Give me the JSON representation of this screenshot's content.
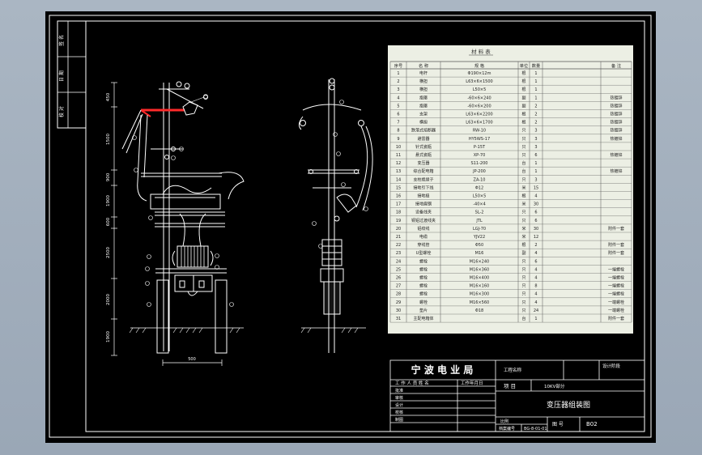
{
  "sheet": {
    "side_strip": [
      "签 名",
      "日 期",
      "校 对"
    ],
    "dims_left": [
      "450",
      "1500",
      "900",
      "1900",
      "600",
      "2500",
      "2000",
      "1900"
    ],
    "bottom_dim": "500"
  },
  "material_table": {
    "title": "材  料  表",
    "headers": [
      "序号",
      "名 称",
      "规 格",
      "单位",
      "数量",
      "备 注"
    ],
    "rows": [
      [
        "1",
        "电杆",
        "Φ190×12m",
        "根",
        "1",
        ""
      ],
      [
        "2",
        "横担",
        "L63×6×1500",
        "根",
        "1",
        ""
      ],
      [
        "3",
        "横担",
        "L50×5",
        "根",
        "1",
        ""
      ],
      [
        "4",
        "抱箍",
        "-60×6×240",
        "副",
        "1",
        "热镀锌"
      ],
      [
        "5",
        "抱箍",
        "-60×6×200",
        "副",
        "2",
        "热镀锌"
      ],
      [
        "6",
        "支架",
        "L63×6×2200",
        "根",
        "2",
        "热镀锌"
      ],
      [
        "7",
        "横担",
        "L63×6×1700",
        "根",
        "2",
        "热镀锌"
      ],
      [
        "8",
        "跌落式熔断器",
        "RW-10",
        "只",
        "3",
        "热镀锌"
      ],
      [
        "9",
        "避雷器",
        "HY5WS-17",
        "只",
        "3",
        "热镀锌"
      ],
      [
        "10",
        "针式瓷瓶",
        "P-15T",
        "只",
        "3",
        ""
      ],
      [
        "11",
        "悬式瓷瓶",
        "XP-70",
        "只",
        "6",
        "热镀锌"
      ],
      [
        "12",
        "变压器",
        "S11-200",
        "台",
        "1",
        ""
      ],
      [
        "13",
        "综合配电箱",
        "JP-200",
        "台",
        "1",
        "热镀锌"
      ],
      [
        "14",
        "支柱绝缘子",
        "ZA-10",
        "只",
        "3",
        ""
      ],
      [
        "15",
        "接地引下线",
        "Φ12",
        "米",
        "15",
        ""
      ],
      [
        "16",
        "接地极",
        "L50×5",
        "根",
        "4",
        ""
      ],
      [
        "17",
        "接地扁钢",
        "-40×4",
        "米",
        "30",
        ""
      ],
      [
        "18",
        "设备线夹",
        "SL-2",
        "只",
        "6",
        ""
      ],
      [
        "19",
        "铜铝过渡线夹",
        "JTL",
        "只",
        "6",
        ""
      ],
      [
        "20",
        "铝绞线",
        "LGJ-70",
        "米",
        "30",
        "附件一套"
      ],
      [
        "21",
        "电缆",
        "YJV22",
        "米",
        "12",
        ""
      ],
      [
        "22",
        "穿线管",
        "Φ50",
        "根",
        "2",
        "附件一套"
      ],
      [
        "23",
        "U型螺栓",
        "M16",
        "副",
        "4",
        "附件一套"
      ],
      [
        "24",
        "螺栓",
        "M16×240",
        "只",
        "6",
        ""
      ],
      [
        "25",
        "螺栓",
        "M16×360",
        "只",
        "4",
        "一端螺栓"
      ],
      [
        "26",
        "螺栓",
        "M16×400",
        "只",
        "4",
        "一端螺栓"
      ],
      [
        "27",
        "螺栓",
        "M16×160",
        "只",
        "8",
        "一端螺栓"
      ],
      [
        "28",
        "螺栓",
        "M16×300",
        "只",
        "4",
        "一端螺栓"
      ],
      [
        "29",
        "螺栓",
        "M16×560",
        "只",
        "4",
        "一端螺栓"
      ],
      [
        "30",
        "垫片",
        "Φ18",
        "只",
        "24",
        "一端螺栓"
      ],
      [
        "31",
        "主配电箱体",
        "",
        "台",
        "1",
        "附件一套"
      ]
    ]
  },
  "title_block": {
    "org": "宁 波 电 业 局",
    "project_label": "工程名称",
    "design_stage_label": "设计阶段",
    "item_label": "项  目",
    "item_value": "10KV部分",
    "approvers_header": "工 作 人 员 姓 名",
    "date_header": "工作年月日",
    "roles": [
      "批准",
      "审核",
      "设计",
      "校核",
      "制图"
    ],
    "drawing_name": "变压器组装图",
    "ratio_label": "比例",
    "drawing_no_label": "图  号",
    "drawing_no": "B02",
    "code_label": "档案编号",
    "code_value": "BG-8-01-01"
  },
  "colors": {
    "paper": "#000000",
    "frame": "#ffffff",
    "table_bg": "#ecefe4",
    "highlight": "#ff2a2a",
    "background": "#a2afbd"
  }
}
